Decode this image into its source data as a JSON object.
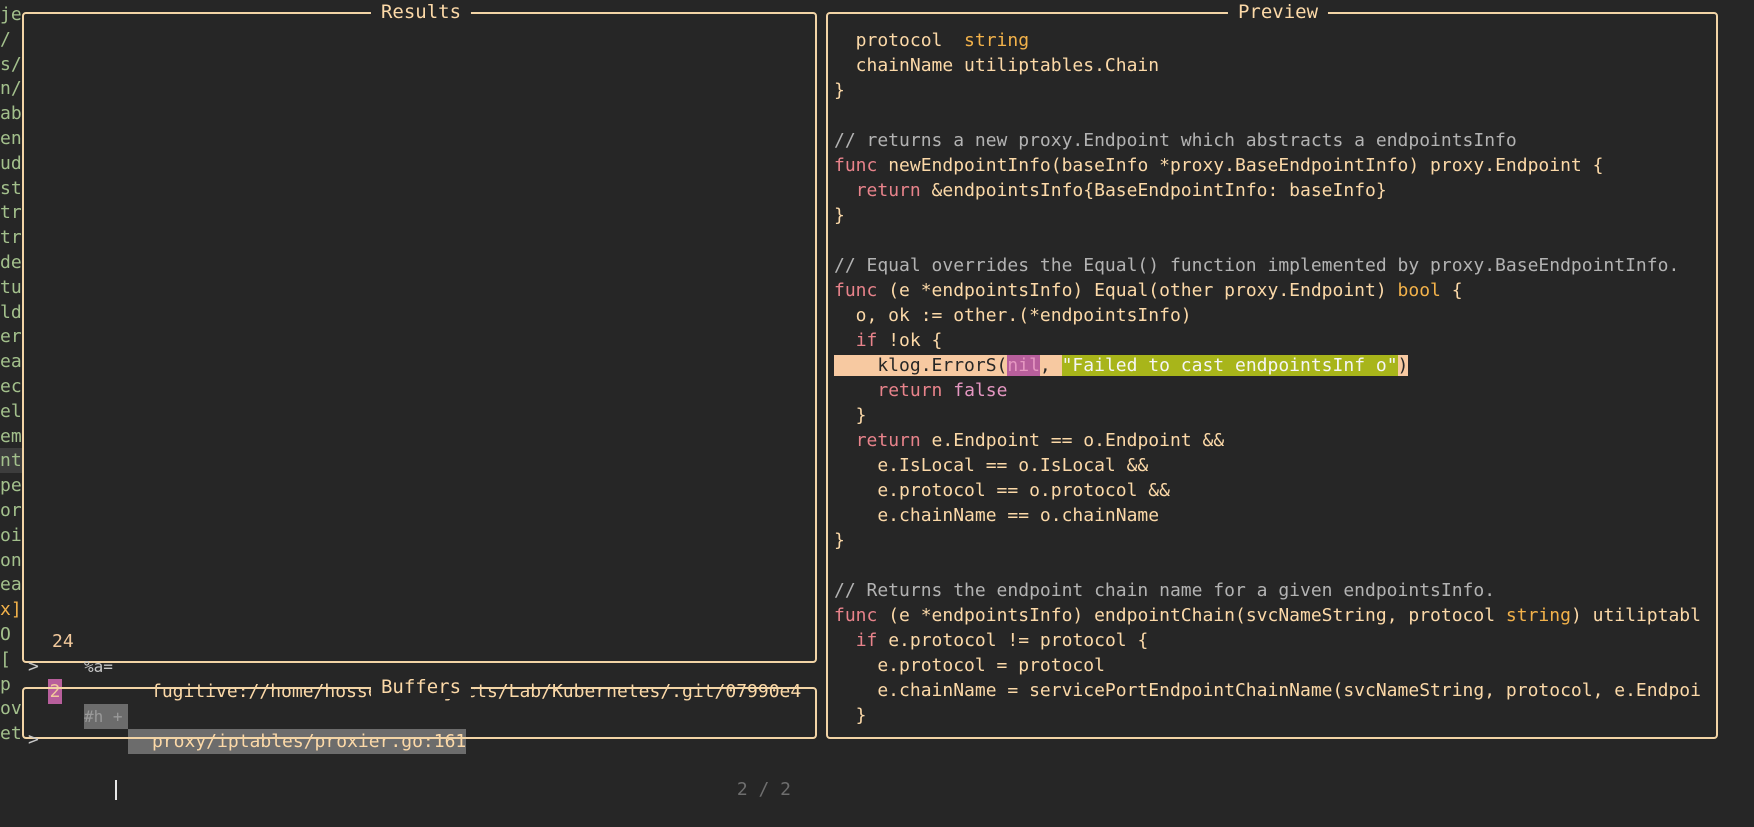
{
  "gutter_lines": [
    "je",
    "/",
    "s/",
    "n/",
    "ab",
    "en",
    "ud",
    "st",
    "tr",
    "tr",
    "de",
    "tu",
    "ld",
    "er",
    "ea",
    "ec",
    "el",
    "em",
    "nt",
    "pe",
    "or",
    "oi",
    "on",
    "ea",
    "x]",
    "O",
    "[",
    "p",
    "ov",
    "et"
  ],
  "results": {
    "title": "Results",
    "items": [
      {
        "num": "24",
        "flags": "%a=",
        "path": "fugitive://home/hossein/Projects/Lab/Kubernetes/.git/07990e4"
      },
      {
        "pointer": ">",
        "num": "2",
        "flags": "#h +",
        "path": "proxy/iptables/proxier.go:161"
      }
    ]
  },
  "buffers": {
    "title": "Buffers",
    "prompt": ">",
    "value": "",
    "count": "2 / 2"
  },
  "preview": {
    "title": "Preview",
    "lines": [
      [
        [
          "  protocol  ",
          ""
        ],
        [
          "string",
          "ty"
        ]
      ],
      [
        [
          "  chainName utiliptables.Chain",
          ""
        ]
      ],
      [
        [
          "}",
          ""
        ]
      ],
      [
        [
          "",
          ""
        ]
      ],
      [
        [
          "// returns a new proxy.Endpoint which abstracts a endpointsInfo",
          "cm"
        ]
      ],
      [
        [
          "func",
          "kw"
        ],
        [
          " newEndpointInfo(baseInfo *proxy.BaseEndpointInfo) proxy.Endpoint {",
          ""
        ]
      ],
      [
        [
          "  ",
          ""
        ],
        [
          "return",
          "kw"
        ],
        [
          " &endpointsInfo{BaseEndpointInfo: baseInfo}",
          ""
        ]
      ],
      [
        [
          "}",
          ""
        ]
      ],
      [
        [
          "",
          ""
        ]
      ],
      [
        [
          "// Equal overrides the Equal() function implemented by proxy.BaseEndpointInfo.",
          "cm"
        ]
      ],
      [
        [
          "func",
          "kw"
        ],
        [
          " (e *endpointsInfo) Equal(other proxy.Endpoint) ",
          ""
        ],
        [
          "bool",
          "ty"
        ],
        [
          " {",
          ""
        ]
      ],
      [
        [
          "  o, ok := other.(*endpointsInfo)",
          ""
        ]
      ],
      [
        [
          "  ",
          ""
        ],
        [
          "if",
          "kw"
        ],
        [
          " !ok {",
          ""
        ]
      ],
      [
        [
          "    klog.ErrorS(",
          "hlbg"
        ],
        [
          "nil",
          "nil"
        ],
        [
          ", ",
          "hlbg"
        ],
        [
          "\"Failed to cast endpointsInf o\"",
          "str"
        ],
        [
          ")",
          "hlbg"
        ]
      ],
      [
        [
          "    ",
          ""
        ],
        [
          "return",
          "kw"
        ],
        [
          " ",
          ""
        ],
        [
          "false",
          "bo"
        ]
      ],
      [
        [
          "  }",
          ""
        ]
      ],
      [
        [
          "  ",
          ""
        ],
        [
          "return",
          "kw"
        ],
        [
          " e.Endpoint == o.Endpoint &&",
          ""
        ]
      ],
      [
        [
          "    e.IsLocal == o.IsLocal &&",
          ""
        ]
      ],
      [
        [
          "    e.protocol == o.protocol &&",
          ""
        ]
      ],
      [
        [
          "    e.chainName == o.chainName",
          ""
        ]
      ],
      [
        [
          "}",
          ""
        ]
      ],
      [
        [
          "",
          ""
        ]
      ],
      [
        [
          "// Returns the endpoint chain name for a given endpointsInfo.",
          "cm"
        ]
      ],
      [
        [
          "func",
          "kw"
        ],
        [
          " (e *endpointsInfo) endpointChain(svcNameString, protocol ",
          ""
        ],
        [
          "string",
          "ty"
        ],
        [
          ") utiliptabl",
          ""
        ]
      ],
      [
        [
          "  ",
          ""
        ],
        [
          "if",
          "kw"
        ],
        [
          " e.protocol != protocol {",
          ""
        ]
      ],
      [
        [
          "    e.protocol = protocol",
          ""
        ]
      ],
      [
        [
          "    e.chainName = servicePortEndpointChainName(svcNameString, protocol, e.Endpoi",
          ""
        ]
      ],
      [
        [
          "  }",
          ""
        ]
      ]
    ]
  },
  "colors": {
    "background": "#262626",
    "border": "#f2d4a6",
    "foreground": "#fcd9a8",
    "keyword": "#e8838b",
    "type": "#f3b24a",
    "comment": "#b3b3b3",
    "string_bg": "#a8b51a",
    "highlight_line_bg": "#f7c9a1"
  }
}
